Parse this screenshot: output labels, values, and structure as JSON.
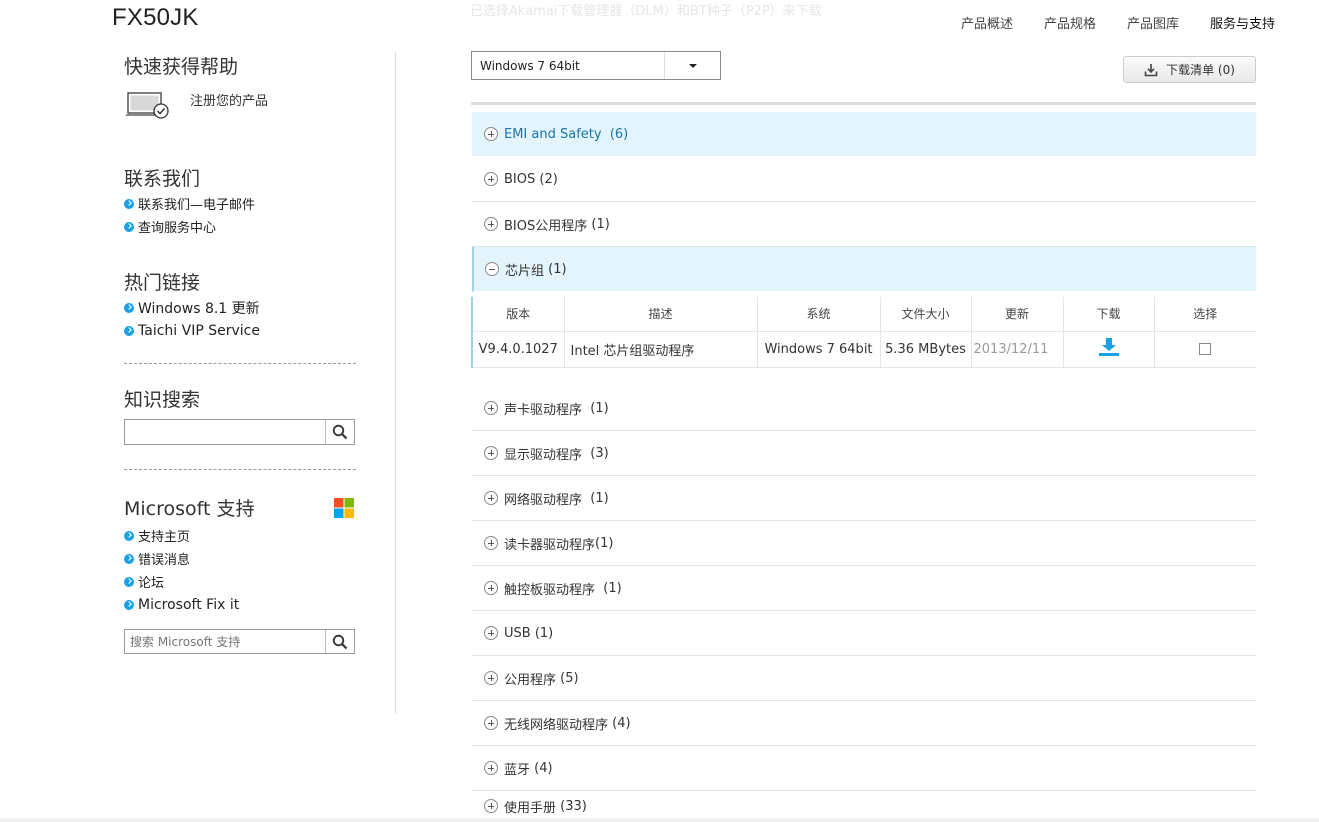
{
  "header": {
    "model": "FX50JK",
    "ghost_notice": "已选择Akamai下载管理器（DLM）和BT种子（P2P）来下载",
    "nav": [
      "产品概述",
      "产品规格",
      "产品图库",
      "服务与支持"
    ]
  },
  "sidebar": {
    "quick_help": {
      "title": "快速获得帮助",
      "register_label": "注册您的产品"
    },
    "contact": {
      "title": "联系我们",
      "links": [
        "联系我们—电子邮件",
        "查询服务中心"
      ]
    },
    "hot_links": {
      "title": "热门链接",
      "links": [
        "Windows 8.1 更新",
        "Taichi VIP Service"
      ]
    },
    "knowledge": {
      "title": "知识搜索",
      "placeholder": ""
    },
    "microsoft": {
      "title": "Microsoft 支持",
      "links": [
        "支持主页",
        "错误消息",
        "论坛",
        "Microsoft Fix it"
      ],
      "search_placeholder": "搜索 Microsoft 支持"
    }
  },
  "main": {
    "os_select": "Windows 7 64bit",
    "download_list": "下载清单 (0)",
    "categories": [
      {
        "label": "EMI and Safety",
        "count": "(6)"
      },
      {
        "label": "BIOS",
        "count": "(2)"
      },
      {
        "label": "BIOS公用程序",
        "count": "(1)"
      },
      {
        "label": "芯片组",
        "count": "(1)"
      },
      {
        "label": "声卡驱动程序",
        "count": "(1)"
      },
      {
        "label": "显示驱动程序",
        "count": "(3)"
      },
      {
        "label": "网络驱动程序",
        "count": "(1)"
      },
      {
        "label": "读卡器驱动程序",
        "count": "(1)"
      },
      {
        "label": "触控板驱动程序",
        "count": "(1)"
      },
      {
        "label": "USB",
        "count": "(1)"
      },
      {
        "label": "公用程序",
        "count": "(5)"
      },
      {
        "label": "无线网络驱动程序",
        "count": "(4)"
      },
      {
        "label": "蓝牙",
        "count": "(4)"
      },
      {
        "label": "使用手册",
        "count": "(33)"
      }
    ],
    "table": {
      "headers": [
        "版本",
        "描述",
        "系统",
        "文件大小",
        "更新",
        "下载",
        "选择"
      ],
      "row": {
        "version": "V9.4.0.1027",
        "description": "Intel 芯片组驱动程序",
        "system": "Windows 7 64bit",
        "size": "5.36 MBytes",
        "date": "2013/12/11"
      }
    }
  },
  "colors": {
    "accent": "#1aa0e6",
    "highlight_bg": "#e3f4fc"
  },
  "icons": [
    "laptop-check-icon",
    "chevron-right-icon",
    "search-icon",
    "windows-logo-icon",
    "download-tray-icon",
    "dropdown-arrow-icon",
    "expand-plus-icon",
    "collapse-minus-icon",
    "download-arrow-icon"
  ]
}
